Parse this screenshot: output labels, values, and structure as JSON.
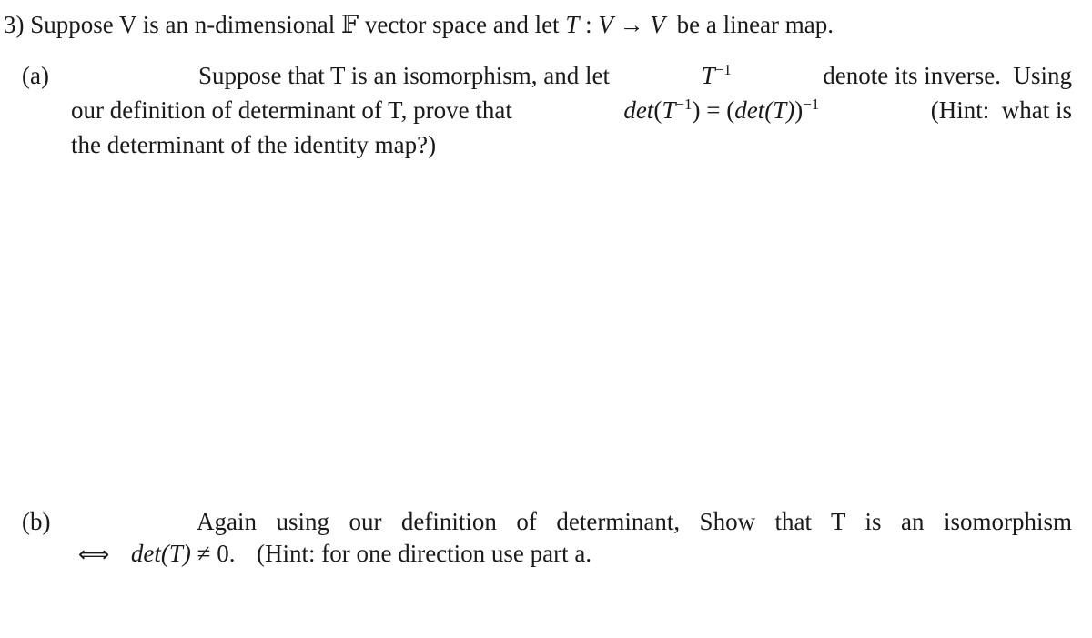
{
  "problem": {
    "number": "3)",
    "intro_prefix": "Suppose V is an n-dimensional",
    "field_symbol": "𝔽",
    "intro_mid": "vector space and let",
    "map_T": "T",
    "map_colon": " : ",
    "map_V1": "V",
    "map_arrow": " → ",
    "map_V2": "V",
    "intro_suffix": "be a linear map."
  },
  "part_a": {
    "label": "(a)",
    "line1_text": "Suppose that T is an isomorphism, and let",
    "line1_T": "T",
    "line1_exp": "−1",
    "line1_rest": "denote its inverse.  Using",
    "line2_text": "our definition of determinant of T, prove that",
    "line2_det1": "det",
    "line2_open1": "(",
    "line2_T1": "T",
    "line2_exp1": "−1",
    "line2_close1": ")",
    "line2_eq": " = ",
    "line2_open2": "(",
    "line2_det2": "det",
    "line2_T2": "(T)",
    "line2_close2": ")",
    "line2_exp2": "−1",
    "line2_rest": "(Hint:  what is",
    "line3_text": "the determinant of the identity map?)"
  },
  "part_b": {
    "label": "(b)",
    "line1_text": "Again using our definition of determinant, Show that T is an isomorphism",
    "iff_symbol": "⟺",
    "line2_det": "det",
    "line2_T": "(T)",
    "line2_neq": " ≠ 0.",
    "line2_rest": "(Hint:  for one direction use part a."
  }
}
